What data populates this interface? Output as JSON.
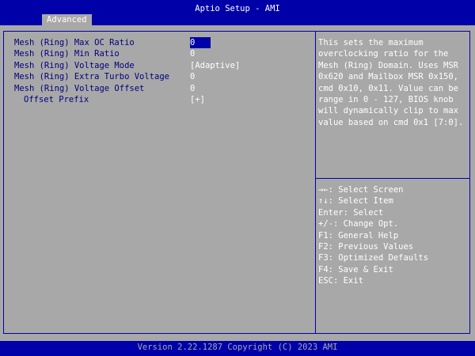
{
  "window": {
    "title": "Aptio Setup - AMI"
  },
  "tabs": [
    {
      "label": "Advanced"
    }
  ],
  "settings": [
    {
      "label": "Mesh (Ring) Max OC Ratio",
      "value": "0"
    },
    {
      "label": "Mesh (Ring) Min Ratio",
      "value": "0"
    },
    {
      "label": "Mesh (Ring) Voltage Mode",
      "value": "[Adaptive]"
    },
    {
      "label": "Mesh (Ring) Extra Turbo Voltage",
      "value": "0"
    },
    {
      "label": "Mesh (Ring) Voltage Offset",
      "value": "0"
    },
    {
      "label": "Offset Prefix",
      "value": "[+]"
    }
  ],
  "help": {
    "lines": [
      "This sets the maximum",
      "overclocking ratio for the",
      "Mesh (Ring) Domain. Uses MSR",
      "0x620 and Mailbox MSR 0x150,",
      "cmd 0x10, 0x11. Value can be",
      "range in 0 - 127, BIOS knob",
      "will dynamically clip to max",
      "value based on cmd 0x1 [7:0]."
    ]
  },
  "keys": [
    "→←: Select Screen",
    "↑↓: Select Item",
    "Enter: Select",
    "+/-: Change Opt.",
    "F1: General Help",
    "F2: Previous Values",
    "F3: Optimized Defaults",
    "F4: Save & Exit",
    "ESC: Exit"
  ],
  "footer": {
    "version": "Version 2.22.1287 Copyright (C) 2023 AMI"
  },
  "colors": {
    "background": "#a8a8a8",
    "accent": "#0000a8",
    "label": "#000080",
    "text": "#ffffff"
  }
}
